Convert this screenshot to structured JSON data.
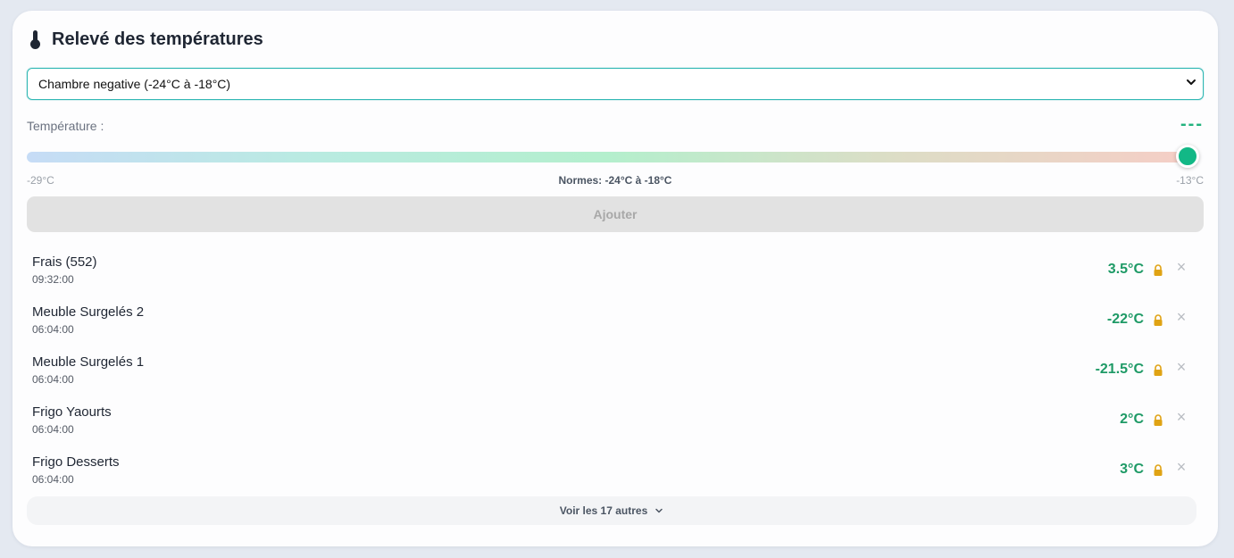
{
  "header": {
    "title": "Relevé des températures",
    "icon": "thermometer-icon"
  },
  "chamber_select": {
    "selected": "Chambre negative (-24°C à -18°C)",
    "focus_color": "#2fb7b3"
  },
  "temperature": {
    "label": "Température :",
    "value_display": "---",
    "slider_min_label": "-29°C",
    "slider_max_label": "-13°C",
    "norms_label": "Normes: -24°C à -18°C",
    "slider_level": 1.0,
    "accent_color": "#12b886"
  },
  "add_button": {
    "label": "Ajouter",
    "disabled": true
  },
  "readings": [
    {
      "name": "Frais (552)",
      "time": "09:32:00",
      "value": "3.5°C",
      "locked": true
    },
    {
      "name": "Meuble Surgelés 2",
      "time": "06:04:00",
      "value": "-22°C",
      "locked": true
    },
    {
      "name": "Meuble Surgelés 1",
      "time": "06:04:00",
      "value": "-21.5°C",
      "locked": true
    },
    {
      "name": "Frigo Yaourts",
      "time": "06:04:00",
      "value": "2°C",
      "locked": true
    },
    {
      "name": "Frigo Desserts",
      "time": "06:04:00",
      "value": "3°C",
      "locked": true
    }
  ],
  "show_more": {
    "label": "Voir les 17 autres",
    "icon": "chevron-down-icon"
  },
  "colors": {
    "reading_ok": "#1e9a66",
    "lock": "#e0a314",
    "background": "#e4e9f1"
  }
}
